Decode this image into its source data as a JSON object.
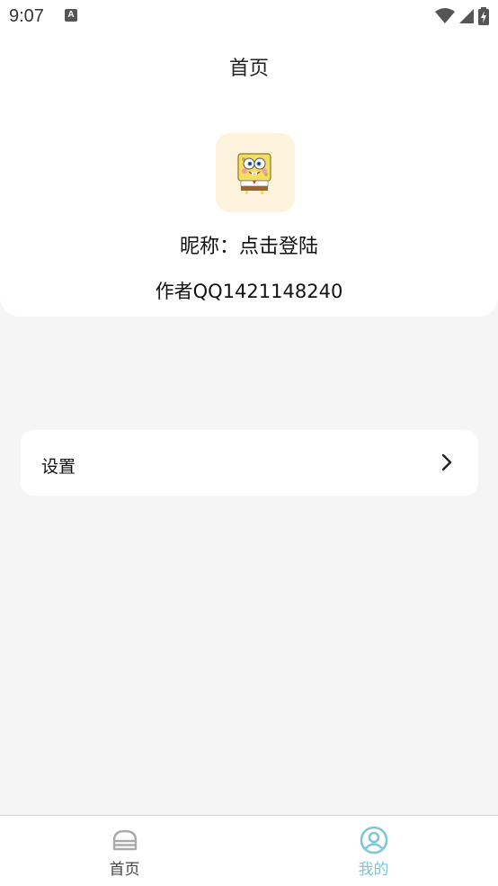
{
  "status_bar": {
    "time": "9:07",
    "notification_icon": "a-icon",
    "icons": [
      "wifi-icon",
      "signal-icon",
      "battery-charging-icon"
    ]
  },
  "header": {
    "title": "首页",
    "avatar_icon": "spongebob-avatar",
    "nickname": "昵称：点击登陆",
    "author": "作者QQ1421148240"
  },
  "settings": {
    "label": "设置",
    "icon": "chevron-right-icon"
  },
  "bottom_nav": {
    "items": [
      {
        "label": "首页",
        "icon": "home-icon",
        "active": false
      },
      {
        "label": "我的",
        "icon": "user-icon",
        "active": true
      }
    ],
    "active_color": "#7fc6dd"
  }
}
